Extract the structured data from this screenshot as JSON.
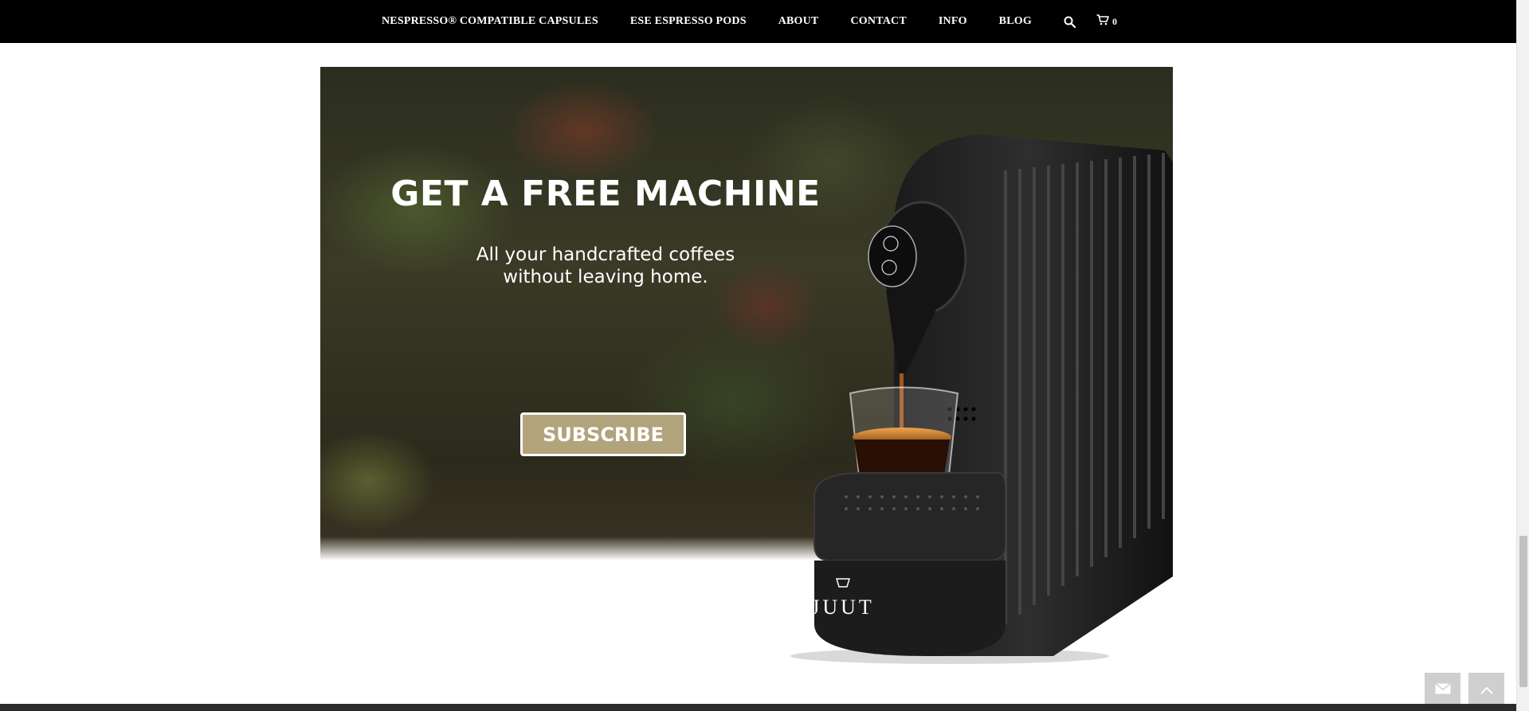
{
  "nav": {
    "items": [
      {
        "label": "NESPRESSO® COMPATIBLE CAPSULES"
      },
      {
        "label": "ESE ESPRESSO PODS"
      },
      {
        "label": "ABOUT"
      },
      {
        "label": "CONTACT"
      },
      {
        "label": "INFO"
      },
      {
        "label": "BLOG"
      }
    ],
    "search_icon": "search-icon",
    "cart_icon": "cart-icon",
    "cart_count": "0"
  },
  "promo": {
    "headline": "GET A FREE MACHINE",
    "subline": "All your handcrafted coffees without leaving home.",
    "button_label": "SUBSCRIBE",
    "machine_brand": "JUUT"
  },
  "floating_buttons": {
    "mail_icon": "envelope-icon",
    "up_icon": "chevron-up-icon"
  },
  "colors": {
    "nav_bg": "#000000",
    "button_bg": "#b1a47d",
    "footer_bg": "#2b2b2b"
  }
}
